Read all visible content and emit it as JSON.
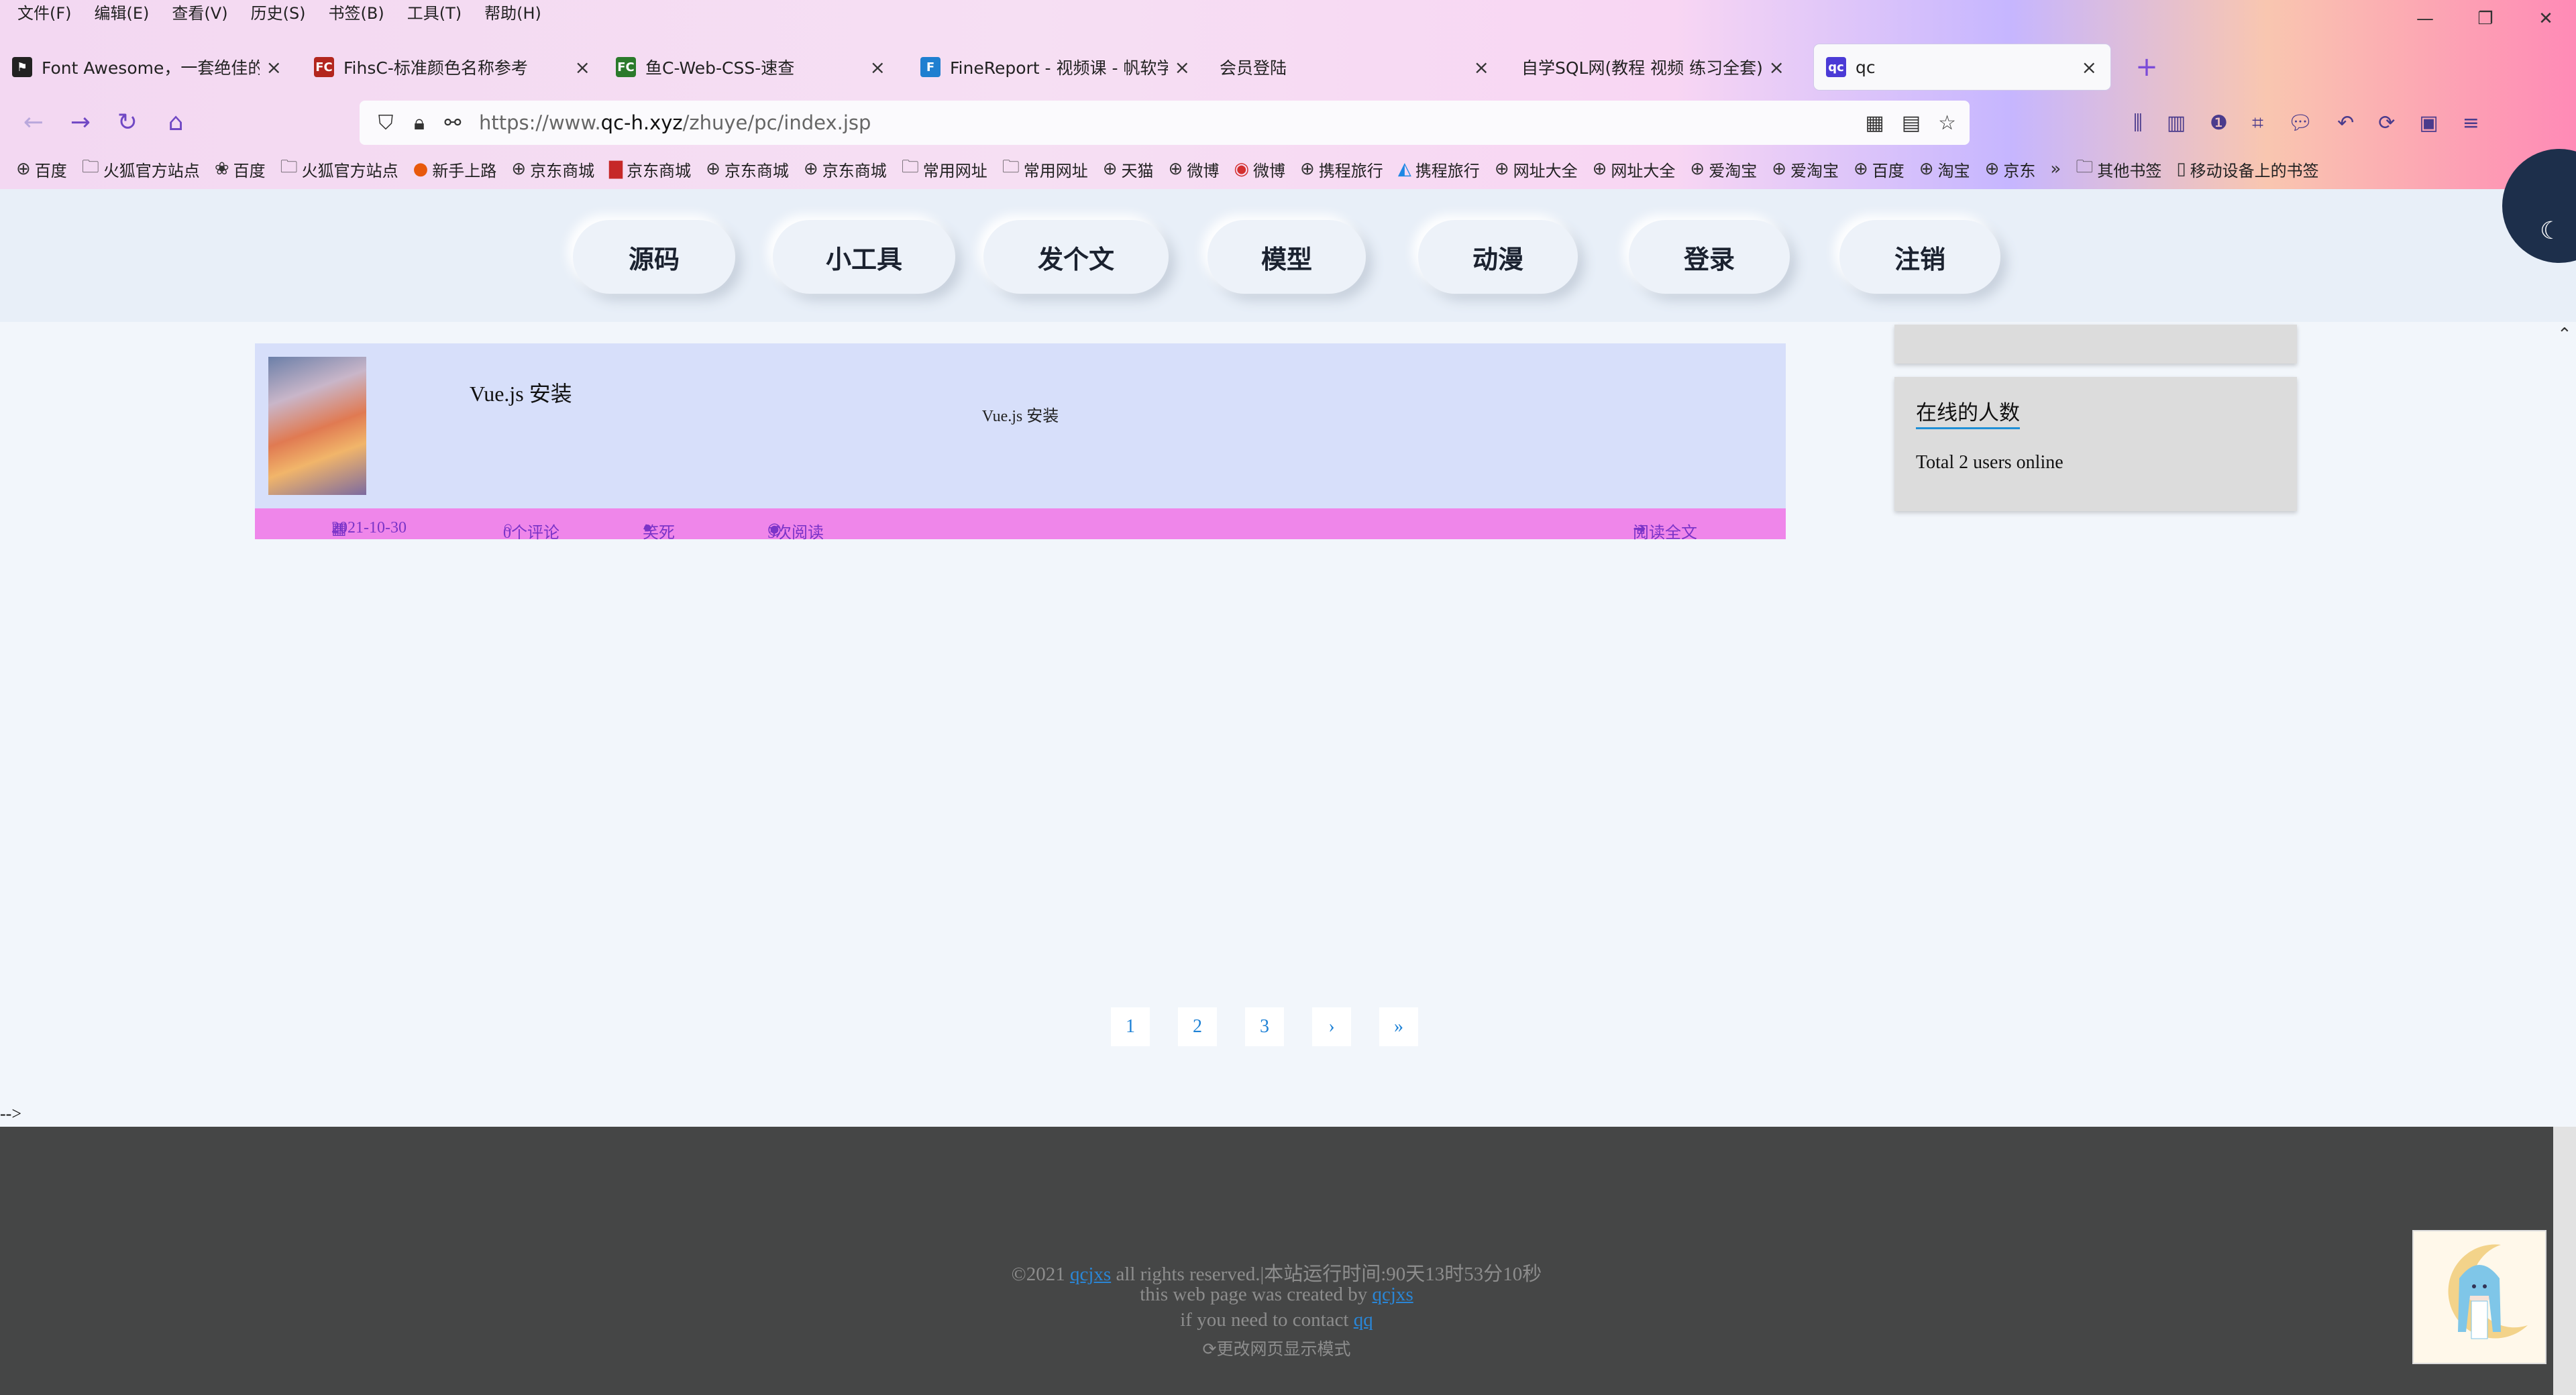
{
  "menubar": [
    "文件(F)",
    "编辑(E)",
    "查看(V)",
    "历史(S)",
    "书签(B)",
    "工具(T)",
    "帮助(H)"
  ],
  "window_controls": [
    "minimize-icon",
    "restore-icon",
    "close-icon"
  ],
  "tabs": [
    {
      "title": "Font Awesome，一套绝佳的图",
      "icon": "flag-icon"
    },
    {
      "title": "FihsC-标准颜色名称参考",
      "icon": "fc-icon"
    },
    {
      "title": "鱼C-Web-CSS-速查",
      "icon": "fc-icon"
    },
    {
      "title": "FineReport - 视频课 - 帆软学",
      "icon": "finereport-icon"
    },
    {
      "title": "会员登陆",
      "icon": ""
    },
    {
      "title": "自学SQL网(教程 视频 练习全套)",
      "icon": ""
    },
    {
      "title": "qc",
      "icon": "qc-icon",
      "active": true
    }
  ],
  "address": {
    "prefix": "https://www.",
    "host": "qc-h.xyz",
    "path": "/zhuye/pc/index.jsp"
  },
  "bookmarks": [
    "百度",
    "火狐官方站点",
    "百度",
    "火狐官方站点",
    "新手上路",
    "京东商城",
    "京东商城",
    "京东商城",
    "京东商城",
    "常用网址",
    "常用网址",
    "天猫",
    "微博",
    "微博",
    "携程旅行",
    "携程旅行",
    "网址大全",
    "网址大全",
    "爱淘宝",
    "爱淘宝",
    "百度",
    "淘宝",
    "京东",
    "其他书签",
    "移动设备上的书签"
  ],
  "site_nav": [
    "源码",
    "小工具",
    "发个文",
    "模型",
    "动漫",
    "登录",
    "注销"
  ],
  "post": {
    "title": "Vue.js 安装",
    "excerpt": "Vue.js 安装",
    "date": "2021-10-30",
    "comments": "0个评论",
    "author": "笑死",
    "reads": "5次阅读",
    "read_more": "阅读全文"
  },
  "sidebar": {
    "heading": "在线的人数",
    "text": "Total 2 users online"
  },
  "pagination": [
    "1",
    "2",
    "3",
    "›",
    "»"
  ],
  "stray_text": "-->",
  "footer": {
    "line1_pre": "©2021 ",
    "line1_link": "qcjxs",
    "line1_post": " all rights reserved.|本站运行时间:90天13时53分10秒",
    "line2_pre": "this web page was created by ",
    "line2_link": "qcjxs",
    "line3_pre": "if you need to contact ",
    "line3_link": "qq",
    "line4": "更改网页显示模式"
  },
  "colors": {
    "card_bg": "#d7dffa",
    "card_footer": "#ef86ea",
    "footer_bg": "#454646",
    "link": "#2a86d6"
  }
}
